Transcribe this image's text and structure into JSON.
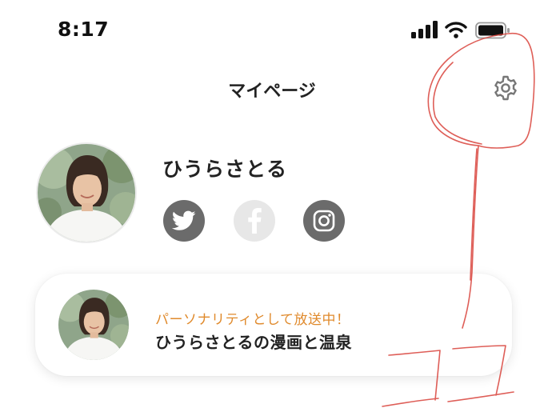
{
  "status_bar": {
    "time": "8:17",
    "icons": [
      "signal-icon",
      "wifi-icon",
      "battery-icon"
    ]
  },
  "header": {
    "title": "マイページ",
    "settings_icon": "gear-icon"
  },
  "profile": {
    "name": "ひうらさとる",
    "social_links": [
      {
        "name": "twitter",
        "icon": "twitter-icon",
        "active": true
      },
      {
        "name": "facebook",
        "icon": "facebook-icon",
        "active": false
      },
      {
        "name": "instagram",
        "icon": "instagram-icon",
        "active": true
      }
    ]
  },
  "personality_card": {
    "status": "パーソナリティとして放送中！",
    "program": "ひうらさとるの漫画と温泉"
  },
  "annotation": {
    "color": "#d9433b",
    "text": "ココ"
  },
  "colors": {
    "accent": "#e08a2c",
    "icon_gray": "#6b6b6b",
    "icon_disabled": "#e7e7e7"
  }
}
